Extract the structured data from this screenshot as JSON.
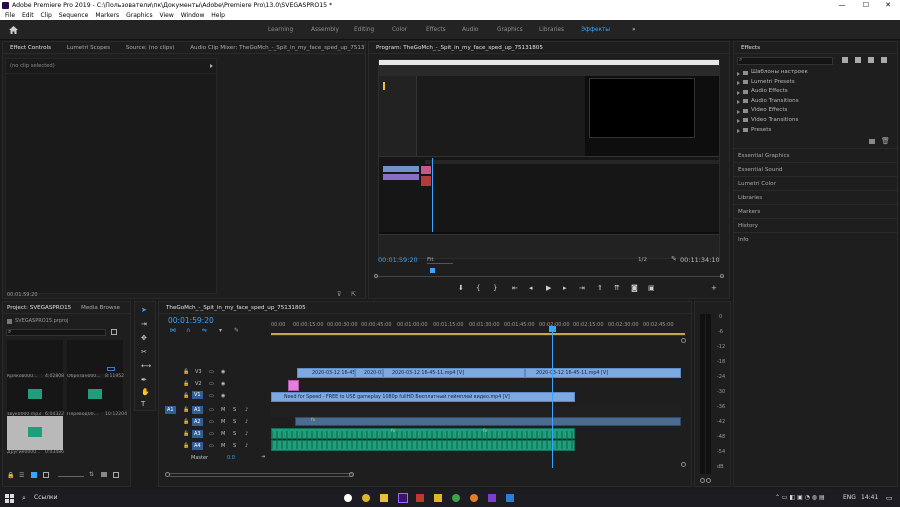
{
  "window": {
    "title": "Adobe Premiere Pro 2019 - C:\\Пользователи\\пк\\Документы\\Adobe\\Premiere Pro\\13.0\\SVEGASPRO15 *",
    "minimize": "—",
    "maximize": "☐",
    "close": "✕"
  },
  "menu": [
    "File",
    "Edit",
    "Clip",
    "Sequence",
    "Markers",
    "Graphics",
    "View",
    "Window",
    "Help"
  ],
  "workspaces": {
    "items": [
      "Learning",
      "Assembly",
      "Editing",
      "Color",
      "Effects",
      "Audio",
      "Graphics",
      "Libraries",
      "Эффекты"
    ],
    "more": "»"
  },
  "source_panel": {
    "tabs": [
      "Effect Controls",
      "Lumetri Scopes",
      "Source: (no clips)",
      "Audio Clip Mixer: TheGoMch_-_Spit_in_my_face_sped_up_75131805"
    ],
    "no_clip": "(no clip selected)",
    "timecode": "00:01:59:20"
  },
  "program": {
    "tab": "Program: TheGoMch_-_Spit_in_my_face_sped_up_75131805",
    "timecode": "00:01:59:20",
    "fit": "Fit",
    "page": "1/2",
    "duration": "00:11:34:10"
  },
  "effects": {
    "tab": "Effects",
    "items": [
      "Шаблоны настроек",
      "Lumetri Presets",
      "Audio Effects",
      "Audio Transitions",
      "Video Effects",
      "Video Transitions",
      "Presets"
    ],
    "sections": [
      "Essential Graphics",
      "Essential Sound",
      "Lumetri Color",
      "Libraries",
      "Markers",
      "History",
      "Info"
    ]
  },
  "project": {
    "tabs": [
      "Project: SVEGASPRO15",
      "Media Browse"
    ],
    "file": "SVEGASPRO15.prproj",
    "items": [
      {
        "name": "Кряков000...",
        "dur": "4:02808"
      },
      {
        "name": "Обрезан000...",
        "dur": "8:11952"
      },
      {
        "name": "звук0000.mp3",
        "dur": "6:04322"
      },
      {
        "name": "Перевод00...",
        "dur": "10:12204"
      },
      {
        "name": "Другие0000...",
        "dur": "0:03486"
      }
    ]
  },
  "timeline": {
    "tab": "TheGoMch_-_Spit_in_my_face_sped_up_75131805",
    "timecode": "00:01:59:20",
    "ruler": [
      "00:00",
      "00:00:15:00",
      "00:00:30:00",
      "00:00:45:00",
      "00:01:00:00",
      "00:01:15:00",
      "00:01:30:00",
      "00:01:45:00",
      "00:02:00:00",
      "00:02:15:00",
      "00:02:30:00",
      "00:02:45:00"
    ],
    "tracks": [
      "V3",
      "V2",
      "V1",
      "A1",
      "A2",
      "A3",
      "A4"
    ],
    "master": "Master",
    "master_val": "0.0",
    "source_patch_v": "V1",
    "source_patch_a": "A1",
    "clips_v3": [
      "2020-03-12 16-45-1",
      "2020-03-",
      "2020-03-12 16-45-11.mp4 [V]",
      "2020-03-12 16-45-11.mp4 [V]"
    ],
    "clip_v1": "Need for Speed - FREE to USE gameplay 1080p fullHD  Бесплатный геймплей видео.mp4 [V]",
    "audio_marker": "fx"
  },
  "meter": {
    "labels": [
      "0",
      "-6",
      "-12",
      "-18",
      "-24",
      "-30",
      "-36",
      "-42",
      "-48",
      "-54",
      "dB"
    ]
  },
  "taskbar": {
    "search": "Ссылки",
    "lang": "ENG",
    "time": "14:41"
  }
}
